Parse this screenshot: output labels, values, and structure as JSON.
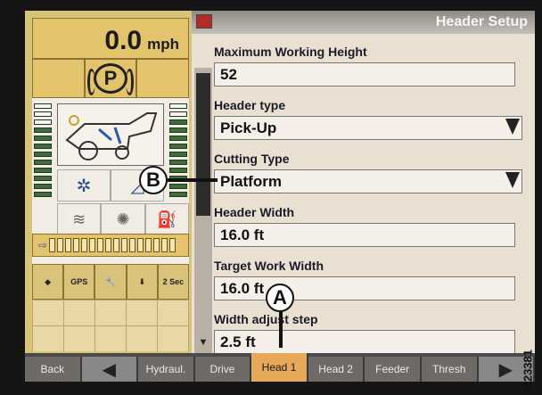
{
  "speed": {
    "value": "0.0",
    "unit": "mph"
  },
  "park_label": "P",
  "header_title": "Header Setup",
  "fields": [
    {
      "label": "Maximum Working Height",
      "value": "52"
    },
    {
      "label": "Header type",
      "value": "Pick-Up"
    },
    {
      "label": "Cutting Type",
      "value": "Platform"
    },
    {
      "label": "Header Width",
      "value": "16.0  ft"
    },
    {
      "label": "Target Work Width",
      "value": "16.0  ft"
    },
    {
      "label": "Width adjust step",
      "value": "2.5  ft"
    }
  ],
  "tool_labels": {
    "gps": "GPS",
    "two_sec": "2 Sec"
  },
  "tabs": [
    {
      "label": "Back"
    },
    {
      "label": "Hydraul."
    },
    {
      "label": "Drive"
    },
    {
      "label": "Head 1"
    },
    {
      "label": "Head 2"
    },
    {
      "label": "Feeder"
    },
    {
      "label": "Thresh"
    }
  ],
  "callouts": {
    "a": "A",
    "b": "B"
  },
  "figure_number": "1023381",
  "colors": {
    "accent": "#e8a85a",
    "panel": "#d9c27a",
    "background": "#e9e0d2"
  }
}
